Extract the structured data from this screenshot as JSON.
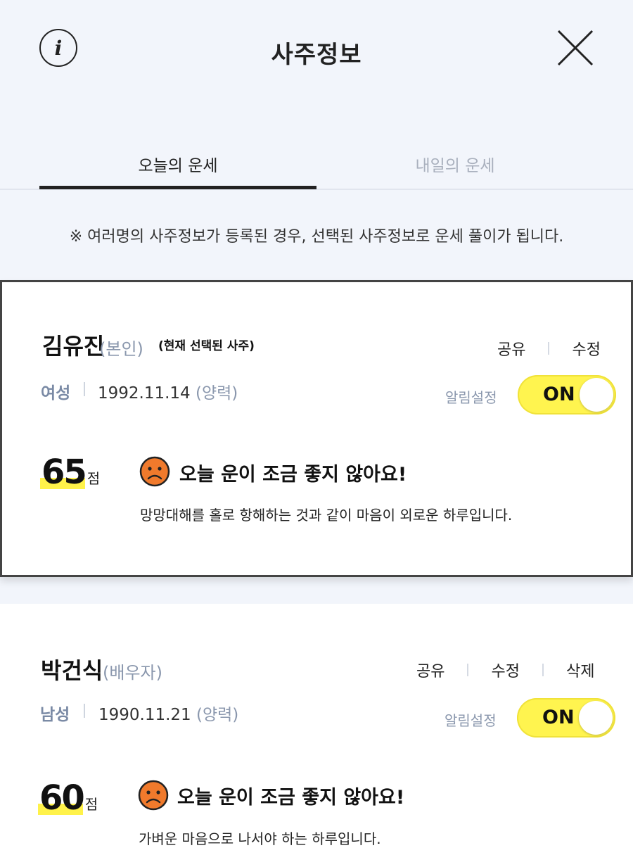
{
  "header": {
    "title": "사주정보",
    "info_icon": "i"
  },
  "tabs": [
    {
      "label": "오늘의 운세",
      "active": true
    },
    {
      "label": "내일의 운세",
      "active": false
    }
  ],
  "notice": "※ 여러명의 사주정보가 등록된 경우, 선택된 사주정보로 운세 풀이가 됩니다.",
  "profiles": [
    {
      "name": "김유진",
      "relation": "(본인)",
      "selected_note": "(현재 선택된 사주)",
      "gender": "여성",
      "birth_date": "1992.11.14",
      "calendar": "(양력)",
      "actions": [
        "공유",
        "수정"
      ],
      "alarm_label": "알림설정",
      "toggle_label": "ON",
      "score": "65",
      "score_unit": "점",
      "headline": "오늘 운이 조금 좋지 않아요!",
      "description": "망망대해를 홀로 항해하는 것과 같이 마음이 외로운 하루입니다."
    },
    {
      "name": "박건식",
      "relation": "(배우자)",
      "gender": "남성",
      "birth_date": "1990.11.21",
      "calendar": "(양력)",
      "actions": [
        "공유",
        "수정",
        "삭제"
      ],
      "alarm_label": "알림설정",
      "toggle_label": "ON",
      "score": "60",
      "score_unit": "점",
      "headline": "오늘 운이 조금 좋지 않아요!",
      "description": "가벼운 마음으로 나서야 하는 하루입니다."
    }
  ],
  "colors": {
    "accent_yellow": "#fff44f",
    "face_orange": "#f07a2c",
    "muted": "#8a97ad"
  }
}
